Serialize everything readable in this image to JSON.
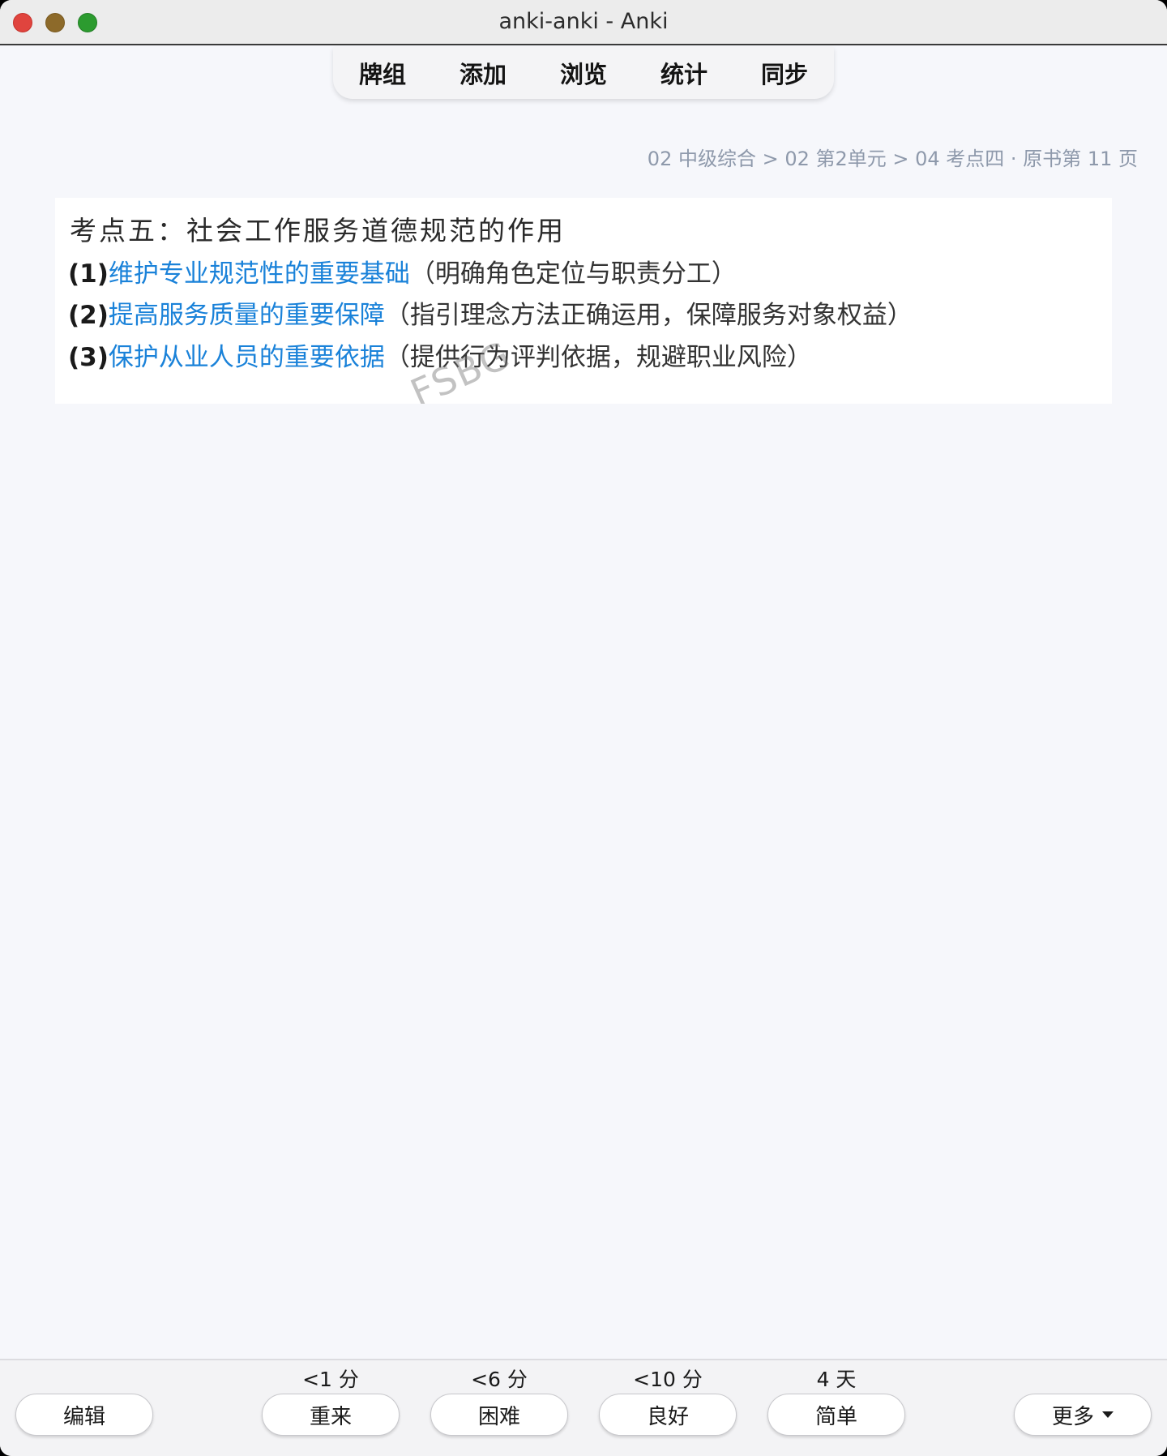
{
  "window": {
    "title": "anki-anki - Anki"
  },
  "nav": {
    "items": [
      "牌组",
      "添加",
      "浏览",
      "统计",
      "同步"
    ]
  },
  "breadcrumb": "02 中级综合 > 02 第2单元 > 04 考点四 · 原书第 11 页",
  "card": {
    "heading": "考点五：社会工作服务道德规范的作用",
    "lines": [
      {
        "num": "(1)",
        "key": "维护专业规范性的重要基础",
        "note": "（明确角色定位与职责分工）"
      },
      {
        "num": "(2)",
        "key": "提高服务质量的重要保障",
        "note": "（指引理念方法正确运用，保障服务对象权益）"
      },
      {
        "num": "(3)",
        "key": "保护从业人员的重要依据",
        "note": "（提供行为评判依据，规避职业风险）"
      }
    ],
    "watermark": "FSBG"
  },
  "footer": {
    "edit_label": "编辑",
    "more_label": "更多",
    "answers": [
      {
        "interval": "<1 分",
        "label": "重来"
      },
      {
        "interval": "<6 分",
        "label": "困难"
      },
      {
        "interval": "<10 分",
        "label": "良好"
      },
      {
        "interval": "4 天",
        "label": "简单"
      }
    ]
  },
  "colors": {
    "highlight": "#1a82d9",
    "breadcrumb": "#8e99ab",
    "background": "#f6f7fb"
  }
}
